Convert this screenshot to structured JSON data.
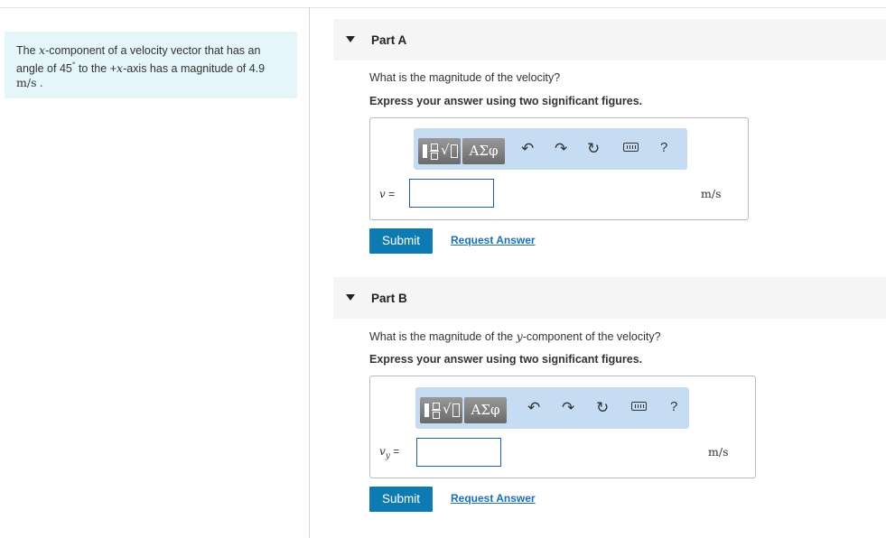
{
  "problem": {
    "prefix": "The ",
    "x": "x",
    "mid1": "-component of a velocity vector that has an angle of 45",
    "degree": "°",
    "mid2": " to the +",
    "x2": "x",
    "mid3": "-axis has a magnitude of 4.9 ",
    "unit": "m/s",
    "end": " ."
  },
  "parts": [
    {
      "title": "Part A",
      "question": "What is the magnitude of the velocity?",
      "instruction": "Express your answer using two significant figures.",
      "toolbar_greek": "ΑΣφ",
      "help": "?",
      "var": "v",
      "eq": " =",
      "answer_value": "",
      "unit": "m/s",
      "submit": "Submit",
      "request": "Request Answer"
    },
    {
      "title": "Part B",
      "question_pre": "What is the magnitude of the ",
      "question_var": "y",
      "question_post": "-component of the velocity?",
      "instruction": "Express your answer using two significant figures.",
      "toolbar_greek": "ΑΣφ",
      "help": "?",
      "var": "v",
      "var_sub": "y",
      "eq": " =",
      "answer_value": "",
      "unit": "m/s",
      "submit": "Submit",
      "request": "Request Answer"
    }
  ],
  "icons": {
    "undo": "undo-icon",
    "redo": "redo-icon",
    "reset": "reset-icon",
    "keyboard": "keyboard-icon",
    "caret": "caret-down-icon"
  }
}
